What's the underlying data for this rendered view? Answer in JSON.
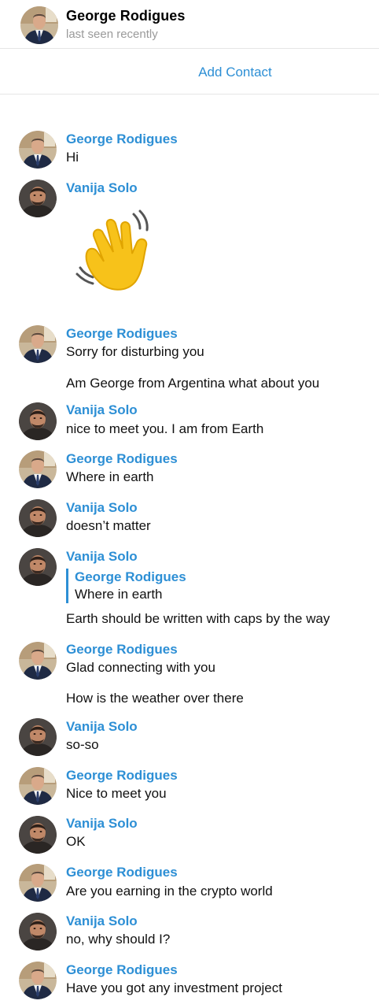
{
  "header": {
    "title": "George Rodigues",
    "status": "last seen recently"
  },
  "add_contact_label": "Add Contact",
  "sticker": {
    "emoji_name": "waving-hand",
    "color": "#f7c21a"
  },
  "messages": [
    {
      "sender": "George Rodigues",
      "avatar": "george",
      "lines": [
        "Hi"
      ]
    },
    {
      "sender": "Vanija Solo",
      "avatar": "vanija",
      "sticker": "waving-hand-icon"
    },
    {
      "sender": "George Rodigues",
      "avatar": "george",
      "lines": [
        "Sorry for disturbing you",
        "Am George from Argentina what about you"
      ]
    },
    {
      "sender": "Vanija Solo",
      "avatar": "vanija",
      "lines": [
        "nice to meet you. I am from Earth"
      ]
    },
    {
      "sender": "George Rodigues",
      "avatar": "george",
      "lines": [
        "Where in earth"
      ]
    },
    {
      "sender": "Vanija Solo",
      "avatar": "vanija",
      "lines": [
        "doesn’t matter"
      ]
    },
    {
      "sender": "Vanija Solo",
      "avatar": "vanija",
      "reply": {
        "sender": "George Rodigues",
        "text": "Where in earth"
      },
      "lines": [
        "Earth should be written with caps by the way"
      ]
    },
    {
      "sender": "George Rodigues",
      "avatar": "george",
      "lines": [
        "Glad connecting with you",
        "How is the weather over there"
      ]
    },
    {
      "sender": "Vanija Solo",
      "avatar": "vanija",
      "lines": [
        "so-so"
      ]
    },
    {
      "sender": "George Rodigues",
      "avatar": "george",
      "lines": [
        "Nice to meet you"
      ]
    },
    {
      "sender": "Vanija Solo",
      "avatar": "vanija",
      "lines": [
        "OK"
      ]
    },
    {
      "sender": "George Rodigues",
      "avatar": "george",
      "lines": [
        "Are you earning in the crypto world"
      ]
    },
    {
      "sender": "Vanija Solo",
      "avatar": "vanija",
      "lines": [
        "no, why should I?"
      ]
    },
    {
      "sender": "George Rodigues",
      "avatar": "george",
      "lines": [
        "Have you got any investment project"
      ]
    }
  ],
  "colors": {
    "accent": "#2d8fd5",
    "muted": "#9a9a9a",
    "divider": "#e6e6e6"
  }
}
